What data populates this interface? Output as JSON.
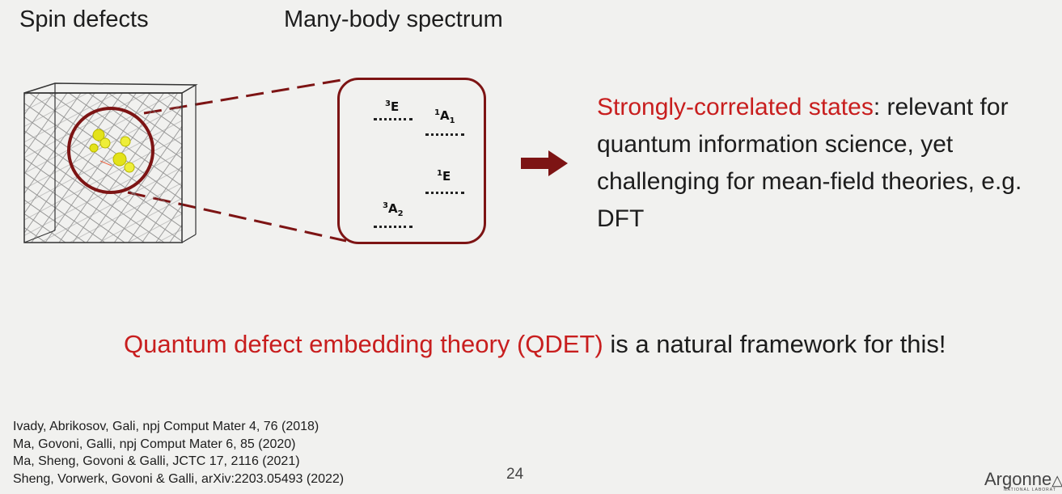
{
  "titles": {
    "left": "Spin defects",
    "right": "Many-body spectrum"
  },
  "spectrum": {
    "levels": [
      {
        "sup": "3",
        "base": "E",
        "sub": ""
      },
      {
        "sup": "1",
        "base": "A",
        "sub": "1"
      },
      {
        "sup": "1",
        "base": "E",
        "sub": ""
      },
      {
        "sup": "3",
        "base": "A",
        "sub": "2"
      }
    ]
  },
  "bullet": {
    "highlight": "Strongly-correlated states",
    "rest": ": relevant for quantum information science, yet challenging for mean-field theories, e.g. DFT"
  },
  "qdet": {
    "highlight": "Quantum defect embedding theory (QDET)",
    "rest": " is a natural framework for this!"
  },
  "references": [
    "Ivady, Abrikosov, Gali, npj Comput Mater 4, 76 (2018)",
    "Ma, Govoni, Galli, npj Comput Mater 6, 85 (2020)",
    "Ma, Sheng, Govoni & Galli, JCTC 17, 2116 (2021)",
    "Sheng, Vorwerk, Govoni & Galli, arXiv:2203.05493 (2022)"
  ],
  "page_number": "24",
  "logo": {
    "name": "Argonne",
    "subtitle": "NATIONAL LABORAT"
  },
  "colors": {
    "accent_red": "#c81e1e",
    "dark_red": "#7d1414",
    "background": "#f1f1ef"
  }
}
